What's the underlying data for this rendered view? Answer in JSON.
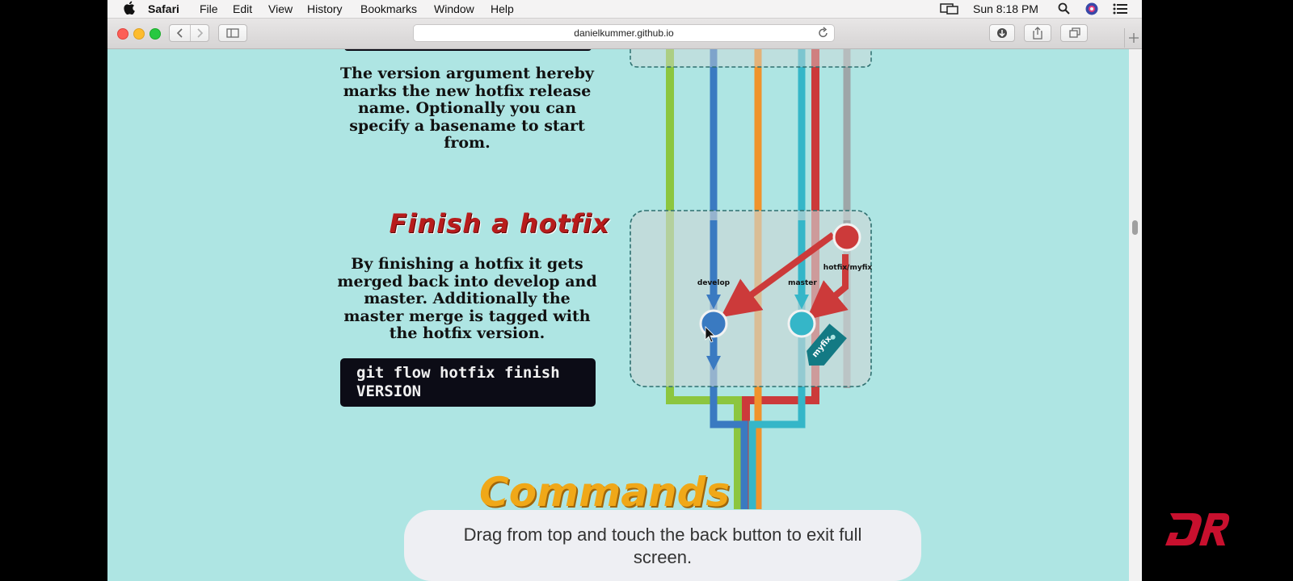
{
  "menubar": {
    "app": "Safari",
    "items": [
      "File",
      "Edit",
      "View",
      "History",
      "Bookmarks",
      "Window",
      "Help"
    ],
    "clock": "Sun 8:18 PM"
  },
  "browser": {
    "url": "danielkummer.github.io"
  },
  "page": {
    "version_paragraph": [
      "The version argument hereby",
      "marks the new hotfix release",
      "name. Optionally you can",
      "specify a basename to start",
      "from."
    ],
    "finish_title": "Finish a hotfix",
    "finish_paragraph": [
      "By finishing a hotfix it gets",
      "merged back into develop and",
      "master. Additionally the",
      "master merge is tagged with",
      "the hotfix version."
    ],
    "code_lines": [
      "git flow hotfix finish",
      "VERSION"
    ],
    "next_heading": "Commands"
  },
  "diagram": {
    "labels": {
      "develop": "develop",
      "master": "master",
      "hotfix": "hotfix/myfix",
      "tag": "myfix"
    },
    "colors": {
      "green": "#8cc63f",
      "blue": "#3a7ac1",
      "orange": "#f0932b",
      "teal": "#35b6c8",
      "red": "#cc3a3a",
      "tag": "#137a84"
    }
  },
  "overlay": {
    "toast_lines": [
      "Drag from top and touch the back button to exit full",
      "screen."
    ]
  }
}
